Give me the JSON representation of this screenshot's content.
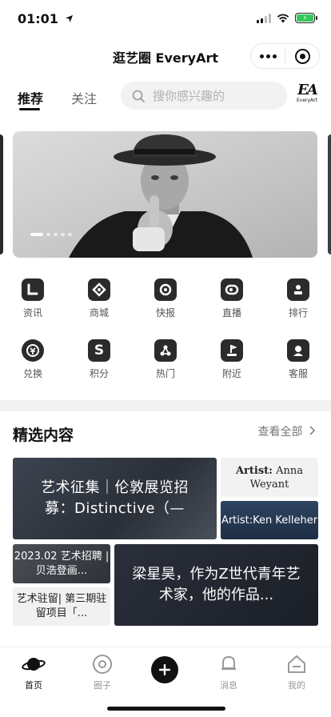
{
  "status": {
    "time": "01:01",
    "battery_fill_percent": 100
  },
  "nav": {
    "title": "逛艺圈 EveryArt"
  },
  "tabs": {
    "recommend": "推荐",
    "follow": "关注"
  },
  "search": {
    "placeholder": "搜你感兴趣的"
  },
  "logo": {
    "mark": "EA",
    "text": "EveryArt"
  },
  "banner": {
    "slide_count": 5,
    "active_slide": 1
  },
  "grid": [
    {
      "label": "资讯",
      "icon": "news-icon"
    },
    {
      "label": "商城",
      "icon": "mall-icon"
    },
    {
      "label": "快报",
      "icon": "bulletin-icon"
    },
    {
      "label": "直播",
      "icon": "live-icon"
    },
    {
      "label": "排行",
      "icon": "ranking-icon"
    },
    {
      "label": "兑换",
      "icon": "exchange-icon"
    },
    {
      "label": "积分",
      "icon": "points-icon"
    },
    {
      "label": "热门",
      "icon": "hot-icon"
    },
    {
      "label": "附近",
      "icon": "nearby-icon"
    },
    {
      "label": "客服",
      "icon": "service-icon"
    }
  ],
  "featured": {
    "title": "精选内容",
    "view_all": "查看全部",
    "cards": [
      {
        "text": "艺术征集｜伦敦展览招募：Distinctive（—"
      },
      {
        "text_prefix": "Artist:",
        "text_name": "Anna Weyant"
      },
      {
        "text": "Artist:Ken Kelleher"
      },
      {
        "text": "2023.02 艺术招聘 | 贝浩登画..."
      },
      {
        "text": "艺术驻留| 第三期驻留项目「..."
      },
      {
        "text": "梁星昊，作为Z世代青年艺术家，他的作品..."
      }
    ]
  },
  "tabbar": {
    "home": "首页",
    "circle": "圈子",
    "messages": "消息",
    "mine": "我的"
  }
}
